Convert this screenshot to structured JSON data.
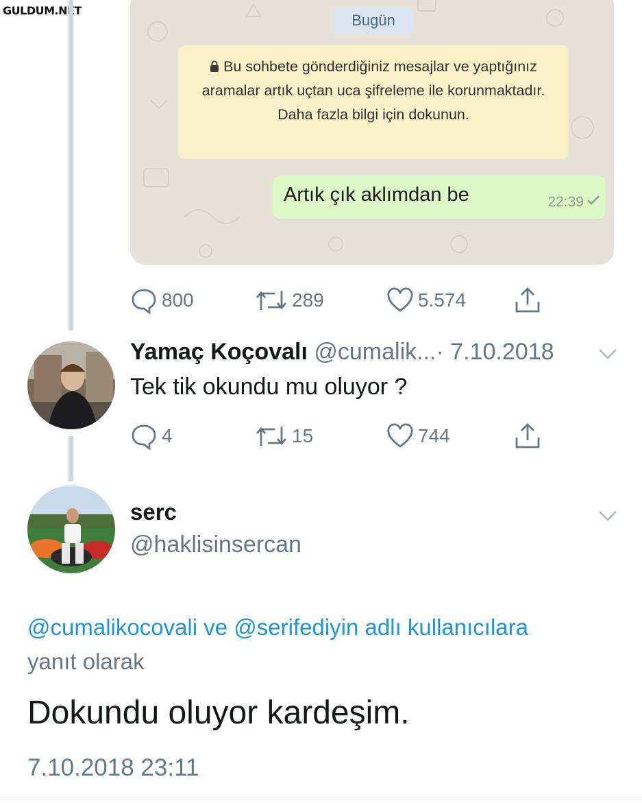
{
  "watermark": "GULDUM.NET",
  "whatsapp": {
    "date_label": "Bugün",
    "system_notice": "Bu sohbete gönderdiğiniz mesajlar ve yaptığınız aramalar artık uçtan uca şifreleme ile korunmaktadır. Daha fazla bilgi için dokunun.",
    "message": "Artık çık aklımdan be",
    "message_time": "22:39"
  },
  "original_tweet_actions": {
    "replies": "800",
    "retweets": "289",
    "likes": "5.574"
  },
  "reply_tweet": {
    "name": "Yamaç Koçovalı",
    "handle": "@cumalik...",
    "date": "· 7.10.2018",
    "text": "Tek tik okundu mu oluyor ?",
    "actions": {
      "replies": "4",
      "retweets": "15",
      "likes": "744"
    }
  },
  "main_tweet": {
    "name": "serc",
    "handle": "@haklisinsercan",
    "mention_1": "@cumalikocovali",
    "connector": "ve",
    "mention_2": "@serifediyin",
    "reply_suffix_link": "adlı kullanıcılara",
    "reply_suffix": "yanıt olarak",
    "text": "Dokundu oluyor kardeşim.",
    "timestamp": "7.10.2018 23:11"
  },
  "colors": {
    "link": "#1b95e0",
    "muted": "#657786",
    "wa_bubble": "#dcf8c6",
    "wa_notice": "#fbf1c8"
  }
}
